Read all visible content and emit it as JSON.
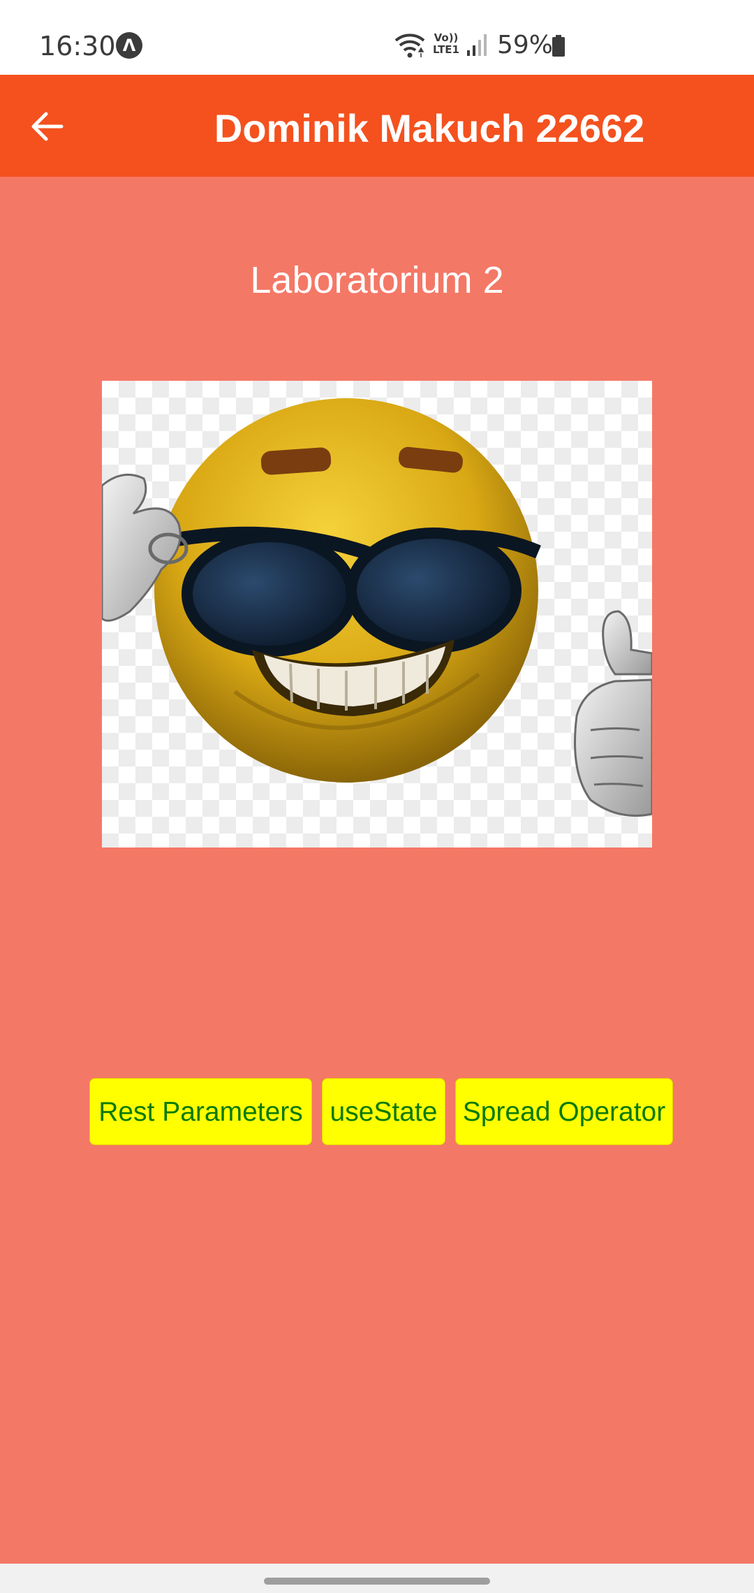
{
  "status_bar": {
    "time": "16:30",
    "app_icon_glyph": "Λ",
    "volte_line1": "Vo))",
    "volte_line2": "LTE1",
    "battery": "59%",
    "icons": [
      "wifi-icon",
      "volte-icon",
      "signal-icon",
      "battery-icon"
    ]
  },
  "app_bar": {
    "title": "Dominik Makuch 22662",
    "back_icon": "arrow-left-icon",
    "color": "#f4511e"
  },
  "content": {
    "heading": "Laboratorium 2",
    "image_description_icon": "cool-emoji-sunglasses-thumbs-up",
    "background_color": "#f47866"
  },
  "buttons": {
    "rest_parameters": "Rest Parameters",
    "use_state": "useState",
    "spread_operator": "Spread Operator",
    "button_color": "#ffff00",
    "text_color": "#0a7a0a"
  }
}
